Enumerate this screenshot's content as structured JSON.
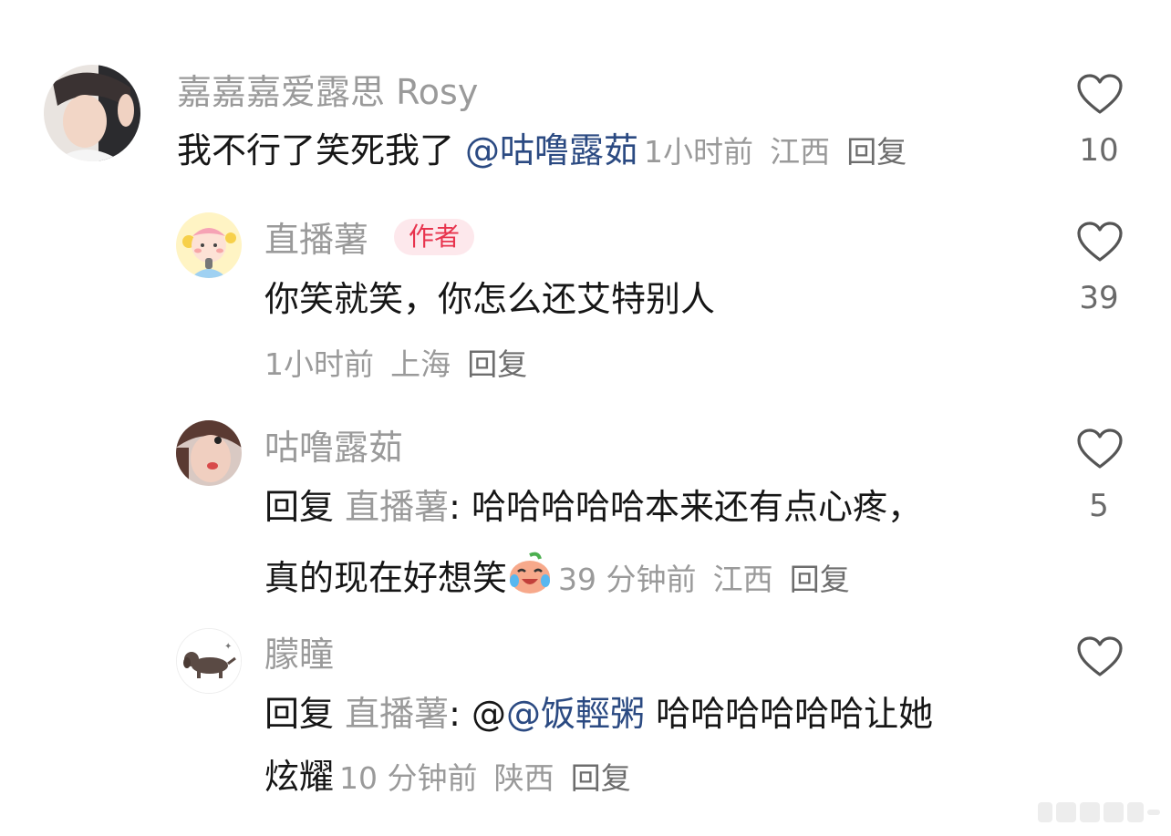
{
  "comments": [
    {
      "username": "嘉嘉嘉爱露思 Rosy",
      "text": "我不行了笑死我了",
      "mention": "@咕噜露茹",
      "time": "1小时前",
      "location": "江西",
      "reply": "回复",
      "likes": "10"
    },
    {
      "username": "直播薯",
      "badge": "作者",
      "text": "你笑就笑，你怎么还艾特别人",
      "time": "1小时前",
      "location": "上海",
      "reply": "回复",
      "likes": "39"
    },
    {
      "username": "咕噜露茹",
      "reply_prefix": "回复",
      "reply_target": "直播薯",
      "text_line1": "哈哈哈哈哈本来还有点心疼，",
      "text_line2": "真的现在好想笑",
      "time": "39 分钟前",
      "location": "江西",
      "reply": "回复",
      "likes": "5"
    },
    {
      "username": "朦瞳",
      "reply_prefix": "回复",
      "reply_target": "直播薯",
      "at_symbol": "@",
      "mention": "@饭輕粥",
      "text_line1_rest": "哈哈哈哈哈哈让她",
      "text_line2": "炫耀",
      "time": "10 分钟前",
      "location": "陕西",
      "reply": "回复",
      "likes": ""
    }
  ],
  "icons": [
    "heart-icon",
    "crying-laughing-emoji"
  ],
  "colors": {
    "name_gray": "#9a9a9a",
    "text": "#161616",
    "mention": "#2b4a82",
    "badge_text": "#e8344e",
    "badge_bg": "#fde8ec"
  }
}
